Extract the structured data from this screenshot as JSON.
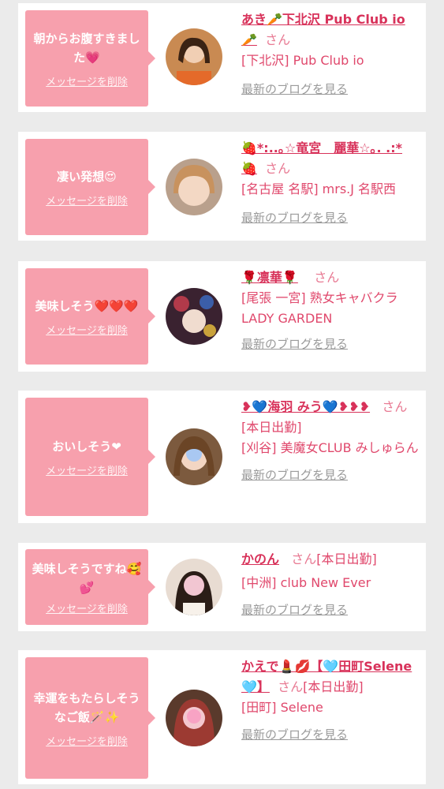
{
  "colors": {
    "background": "#ebebeb",
    "card": "#ffffff",
    "bubble": "#f7a0ad",
    "name": "#d8325a",
    "store": "#e0486c",
    "link_gray": "#9a9a9a"
  },
  "common": {
    "delete_label": "メッセージを削除",
    "blog_label": "最新のブログを見る",
    "san_label": "さん"
  },
  "messages": [
    {
      "message": "朝からお腹すきました💗",
      "name": "あき🥕下北沢 Pub Club io🥕",
      "status": "",
      "store": "[下北沢] Pub Club io",
      "avatar_icon": "woman-portrait-icon"
    },
    {
      "message": "凄い発想😍",
      "name": "🍓*:..｡☆竜宮　麗華☆｡. .:*🍓",
      "status": "",
      "store": "[名古屋 名駅] mrs.J 名駅西",
      "avatar_icon": "woman-portrait-icon"
    },
    {
      "message": "美味しそう❤️❤️❤️",
      "name": "🌹凛華🌹",
      "status": "",
      "store": "[尾張 一宮] 熟女キャバクラ LADY GARDEN",
      "avatar_icon": "woman-portrait-icon"
    },
    {
      "message": "おいしそう❤",
      "name": "❥💙海羽 みう💙❥❥❥",
      "status": "[本日出勤]",
      "store": "[刈谷] 美魔女CLUB みしゅらん",
      "avatar_icon": "woman-portrait-icon"
    },
    {
      "message": "美味しそうですね🥰💕",
      "name": "かのん",
      "status": "[本日出勤]",
      "store": "[中洲] club New Ever",
      "avatar_icon": "woman-portrait-icon"
    },
    {
      "message": "幸運をもたらしそうなご飯🪄✨",
      "name": "かえで💄💋【🩵田町Selene🩵】",
      "status": "[本日出勤]",
      "store": "[田町] Selene",
      "avatar_icon": "woman-portrait-icon"
    }
  ]
}
